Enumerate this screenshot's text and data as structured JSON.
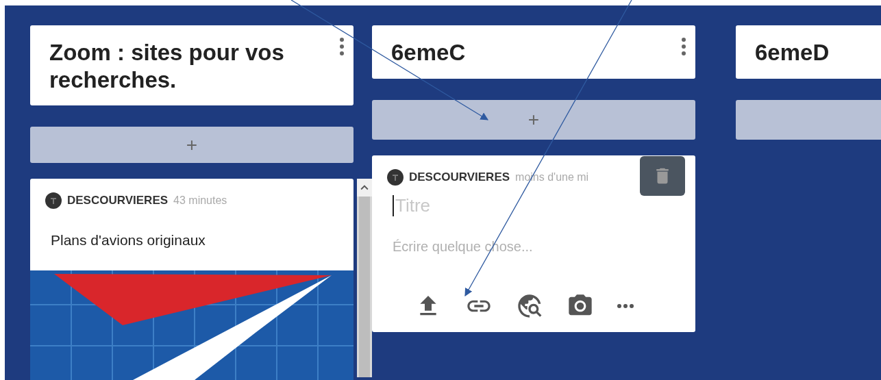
{
  "columns": [
    {
      "title": "Zoom : sites pour vos recherches.",
      "add_label": "+",
      "scrollable": true,
      "posts": [
        {
          "kind": "published",
          "author": "DESCOURVIERES",
          "time": "43 minutes",
          "title": "Plans d'avions originaux"
        }
      ]
    },
    {
      "title": "6emeC",
      "add_label": "+",
      "posts": [
        {
          "kind": "draft",
          "author": "DESCOURVIERES",
          "time": "moins d'une mi",
          "title_placeholder": "Titre",
          "body_placeholder": "Écrire quelque chose..."
        }
      ]
    },
    {
      "title": "6emeD"
    }
  ]
}
